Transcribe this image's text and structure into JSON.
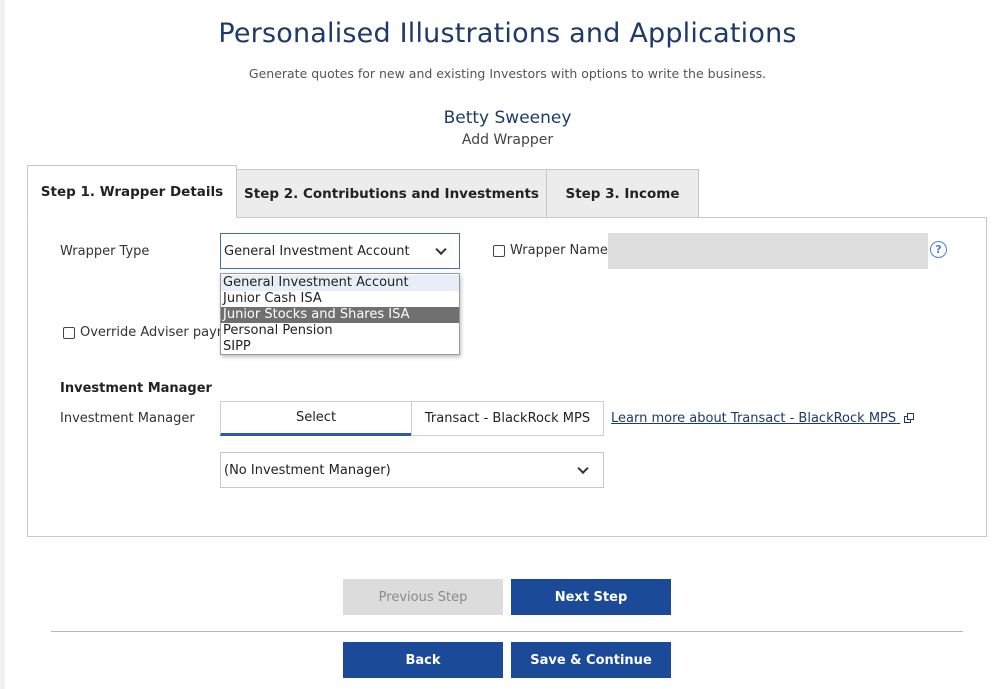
{
  "header": {
    "title": "Personalised Illustrations and Applications",
    "subtitle": "Generate quotes for new and existing Investors with options to write the business.",
    "investor_name": "Betty Sweeney",
    "action": "Add Wrapper"
  },
  "tabs": [
    {
      "label": "Step 1. Wrapper Details",
      "active": true
    },
    {
      "label": "Step 2. Contributions and Investments",
      "active": false
    },
    {
      "label": "Step 3. Income",
      "active": false
    }
  ],
  "form": {
    "wrapper_type_label": "Wrapper Type",
    "wrapper_type_value": "General Investment Account",
    "wrapper_type_options": [
      "General Investment Account",
      "Junior Cash ISA",
      "Junior Stocks and Shares ISA",
      "Personal Pension",
      "SIPP"
    ],
    "wrapper_name_label": "Wrapper Name",
    "wrapper_name_value": "",
    "help_icon_glyph": "?",
    "override_label": "Override Adviser payme"
  },
  "investment_manager": {
    "section_heading": "Investment Manager",
    "label": "Investment Manager",
    "segments": [
      "Select",
      "Transact - BlackRock MPS"
    ],
    "learn_more_link": "Learn more about Transact - BlackRock MPS",
    "dropdown_value": "(No Investment Manager)"
  },
  "buttons": {
    "previous": "Previous Step",
    "next": "Next Step",
    "back": "Back",
    "save_continue": "Save & Continue"
  },
  "icons": [
    "chevron-down-icon",
    "help-icon",
    "external-link-icon",
    "checkbox-icon"
  ],
  "colors": {
    "title": "#1d3a6b",
    "primary_button": "#1b4a99",
    "disabled_button": "#dcdcdc",
    "segment_active": "#2b5aa8",
    "dropdown_hover": "#707070",
    "wrapper_name_input": "#dddddd"
  }
}
